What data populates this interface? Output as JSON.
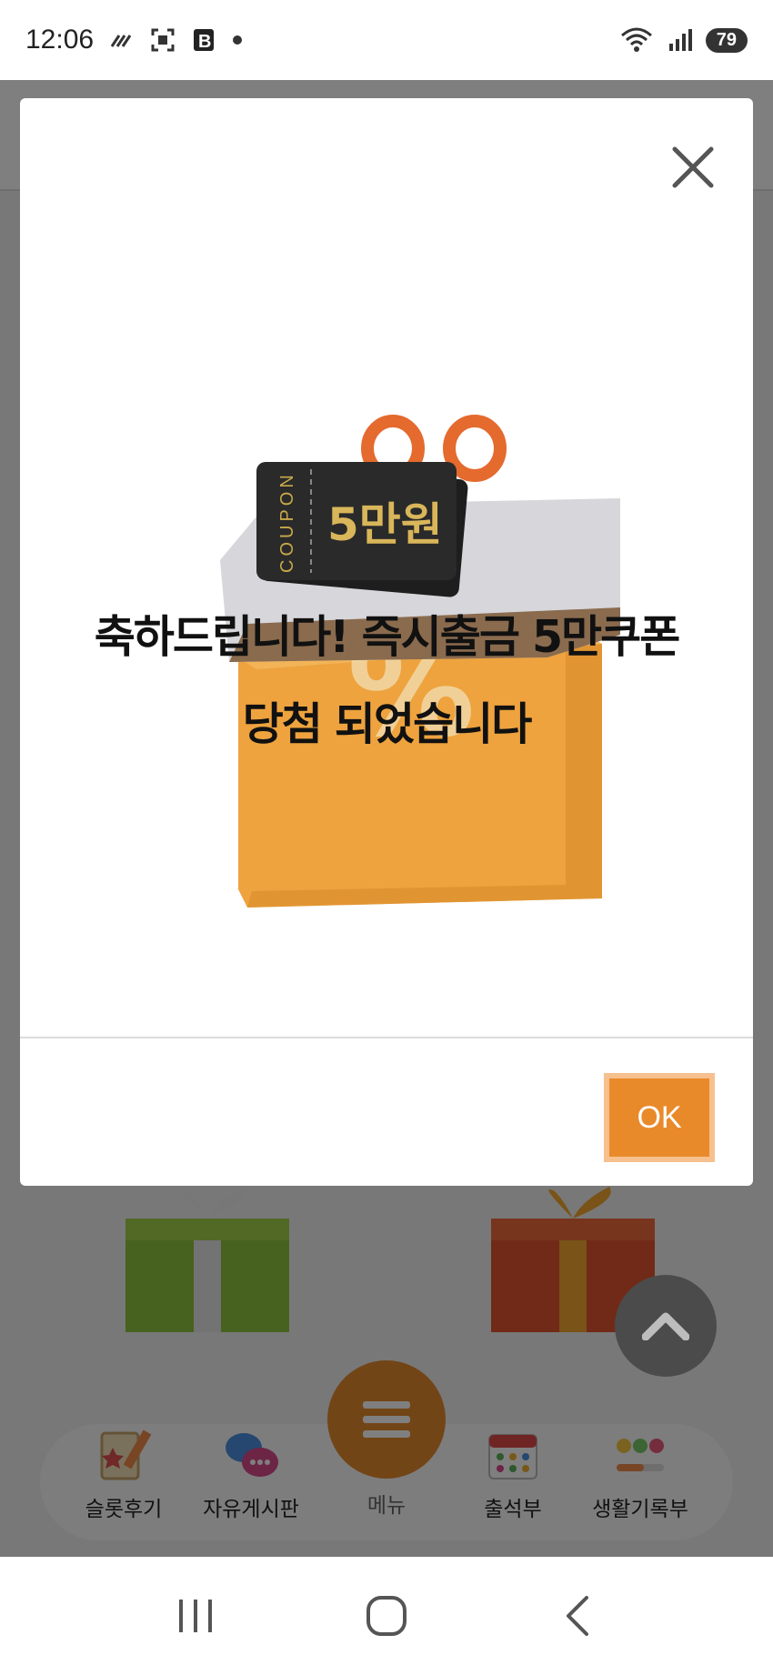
{
  "status_bar": {
    "time": "12:06",
    "battery": "79",
    "wifi_label": "6"
  },
  "modal": {
    "coupon_side_text": "COUPON",
    "coupon_amount": "5만원",
    "message_line1": "축하드립니다! 즉시출금 5만쿠폰",
    "message_line2": "당첨 되었습니다",
    "ok_label": "OK"
  },
  "bottom_menu": {
    "items": [
      {
        "label": "슬롯후기",
        "icon": "review-notepad-icon"
      },
      {
        "label": "자유게시판",
        "icon": "chat-bubbles-icon"
      },
      {
        "label": "메뉴",
        "icon": "hamburger-menu-icon"
      },
      {
        "label": "출석부",
        "icon": "calendar-icon"
      },
      {
        "label": "생활기록부",
        "icon": "emoji-progress-icon"
      }
    ]
  },
  "colors": {
    "accent": "#e98a2a",
    "ok_border": "#f6c08f",
    "overlay": "rgba(0,0,0,0.5)"
  }
}
